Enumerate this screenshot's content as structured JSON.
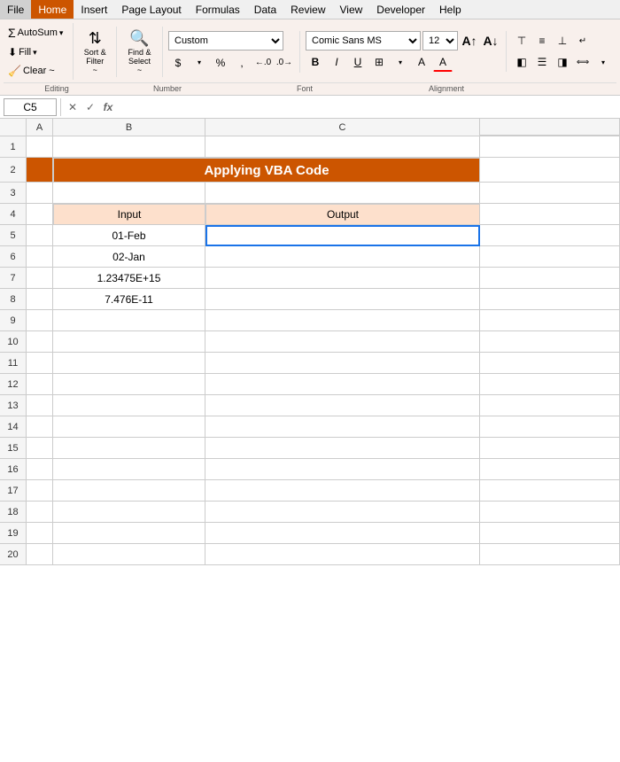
{
  "menubar": {
    "items": [
      "File",
      "Home",
      "Insert",
      "Page Layout",
      "Formulas",
      "Data",
      "Review",
      "View",
      "Developer",
      "Help"
    ],
    "active": "Home"
  },
  "ribbon": {
    "editing_group": {
      "autosum_label": "AutoSum",
      "fill_label": "Fill",
      "clear_label": "Clear ~"
    },
    "sort_group": {
      "sort_label": "Sort &\nFilter ~"
    },
    "find_group": {
      "find_label": "Find &\nSelect ~"
    },
    "number_format": "Custom",
    "font_name": "Comic Sans MS",
    "font_size": "12",
    "bold": "B",
    "italic": "I",
    "underline": "U",
    "group_labels": {
      "editing": "Editing",
      "number": "Number",
      "font": "Font",
      "alignment": "Alignment"
    }
  },
  "formula_bar": {
    "cell_ref": "C5",
    "cancel": "✕",
    "confirm": "✓",
    "fx": "fx",
    "formula": ""
  },
  "spreadsheet": {
    "col_headers": [
      "A",
      "B",
      "C"
    ],
    "title": "Applying VBA Code",
    "table_headers": [
      "Input",
      "Output"
    ],
    "rows": [
      {
        "num": "5",
        "input": "01-Feb",
        "output": ""
      },
      {
        "num": "6",
        "input": "02-Jan",
        "output": ""
      },
      {
        "num": "7",
        "input": "1.23475E+15",
        "output": ""
      },
      {
        "num": "8",
        "input": "7.476E-11",
        "output": ""
      }
    ],
    "row_numbers": [
      "1",
      "2",
      "3",
      "4",
      "5",
      "6",
      "7",
      "8",
      "9",
      "10",
      "11",
      "12",
      "13",
      "14",
      "15",
      "16",
      "17",
      "18",
      "19",
      "20"
    ]
  }
}
